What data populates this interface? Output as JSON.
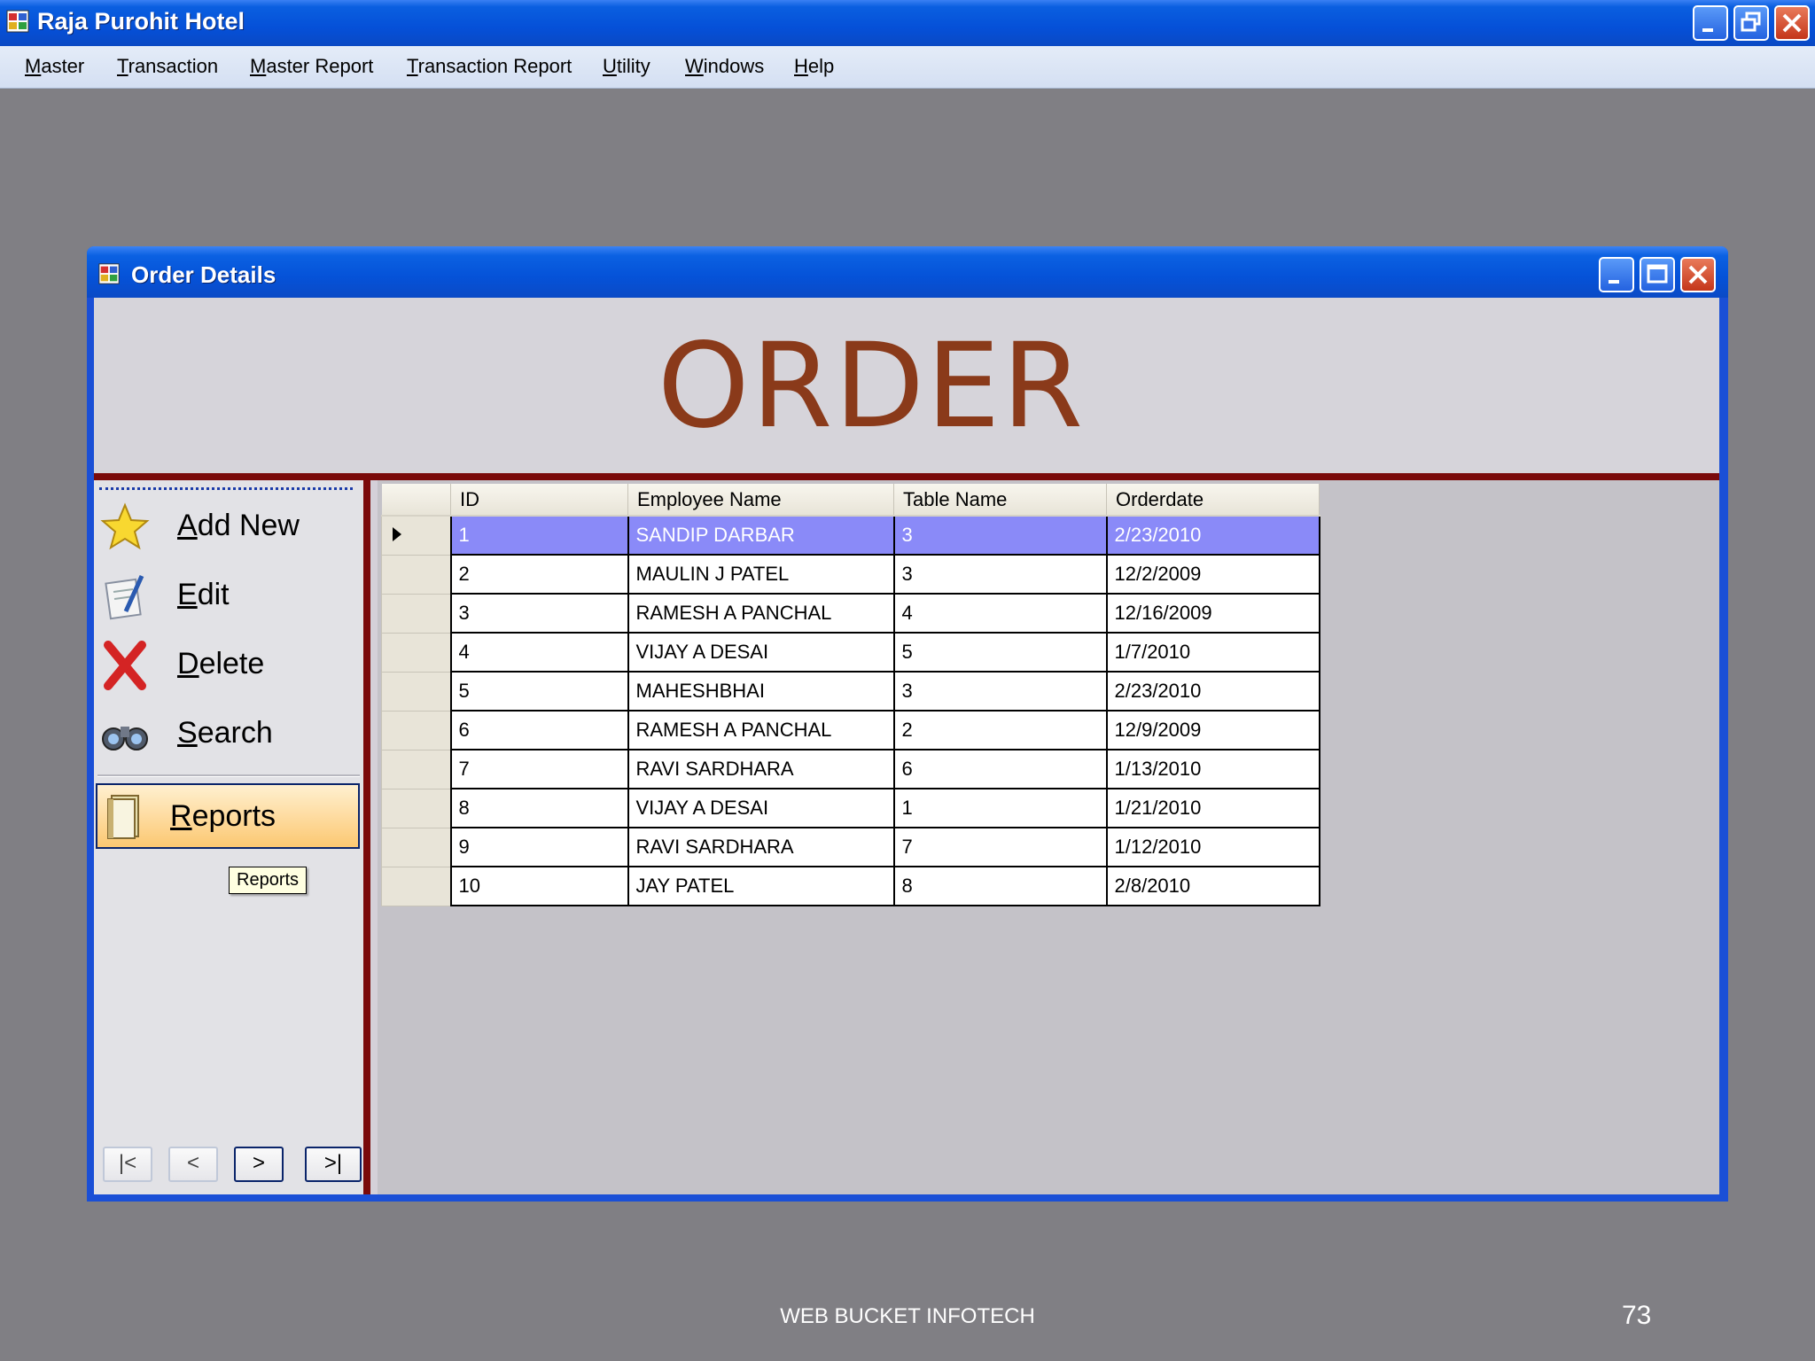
{
  "app": {
    "title": "Raja Purohit Hotel"
  },
  "menu": [
    "Master",
    "Transaction",
    "Master Report",
    "Transaction Report",
    "Utility",
    "Windows",
    "Help"
  ],
  "child_window": {
    "title": "Order Details",
    "header_text": "ORDER"
  },
  "sidebar": {
    "add_new": "Add New",
    "edit": "Edit",
    "delete": "Delete",
    "search": "Search",
    "reports": "Reports",
    "tooltip": "Reports",
    "nav": {
      "first": "|<",
      "prev": "<",
      "next": ">",
      "last": ">|"
    }
  },
  "grid": {
    "columns": [
      "ID",
      "Employee Name",
      "Table Name",
      "Orderdate"
    ],
    "selected_row": 0,
    "rows": [
      [
        "1",
        "SANDIP DARBAR",
        "3",
        "2/23/2010"
      ],
      [
        "2",
        "MAULIN J PATEL",
        "3",
        "12/2/2009"
      ],
      [
        "3",
        "RAMESH A PANCHAL",
        "4",
        "12/16/2009"
      ],
      [
        "4",
        "VIJAY A DESAI",
        "5",
        "1/7/2010"
      ],
      [
        "5",
        "MAHESHBHAI",
        "3",
        "2/23/2010"
      ],
      [
        "6",
        "RAMESH A PANCHAL",
        "2",
        "12/9/2009"
      ],
      [
        "7",
        "RAVI SARDHARA",
        "6",
        "1/13/2010"
      ],
      [
        "8",
        "VIJAY A DESAI",
        "1",
        "1/21/2010"
      ],
      [
        "9",
        "RAVI SARDHARA",
        "7",
        "1/12/2010"
      ],
      [
        "10",
        "JAY PATEL",
        "8",
        "2/8/2010"
      ]
    ]
  },
  "footer": {
    "company": "WEB BUCKET INFOTECH",
    "page": "73"
  },
  "colors": {
    "title_blue": "#0552d8",
    "order_text": "#8a3a1a",
    "selection": "#8a8af8",
    "accent_red": "#7a0a0a"
  }
}
